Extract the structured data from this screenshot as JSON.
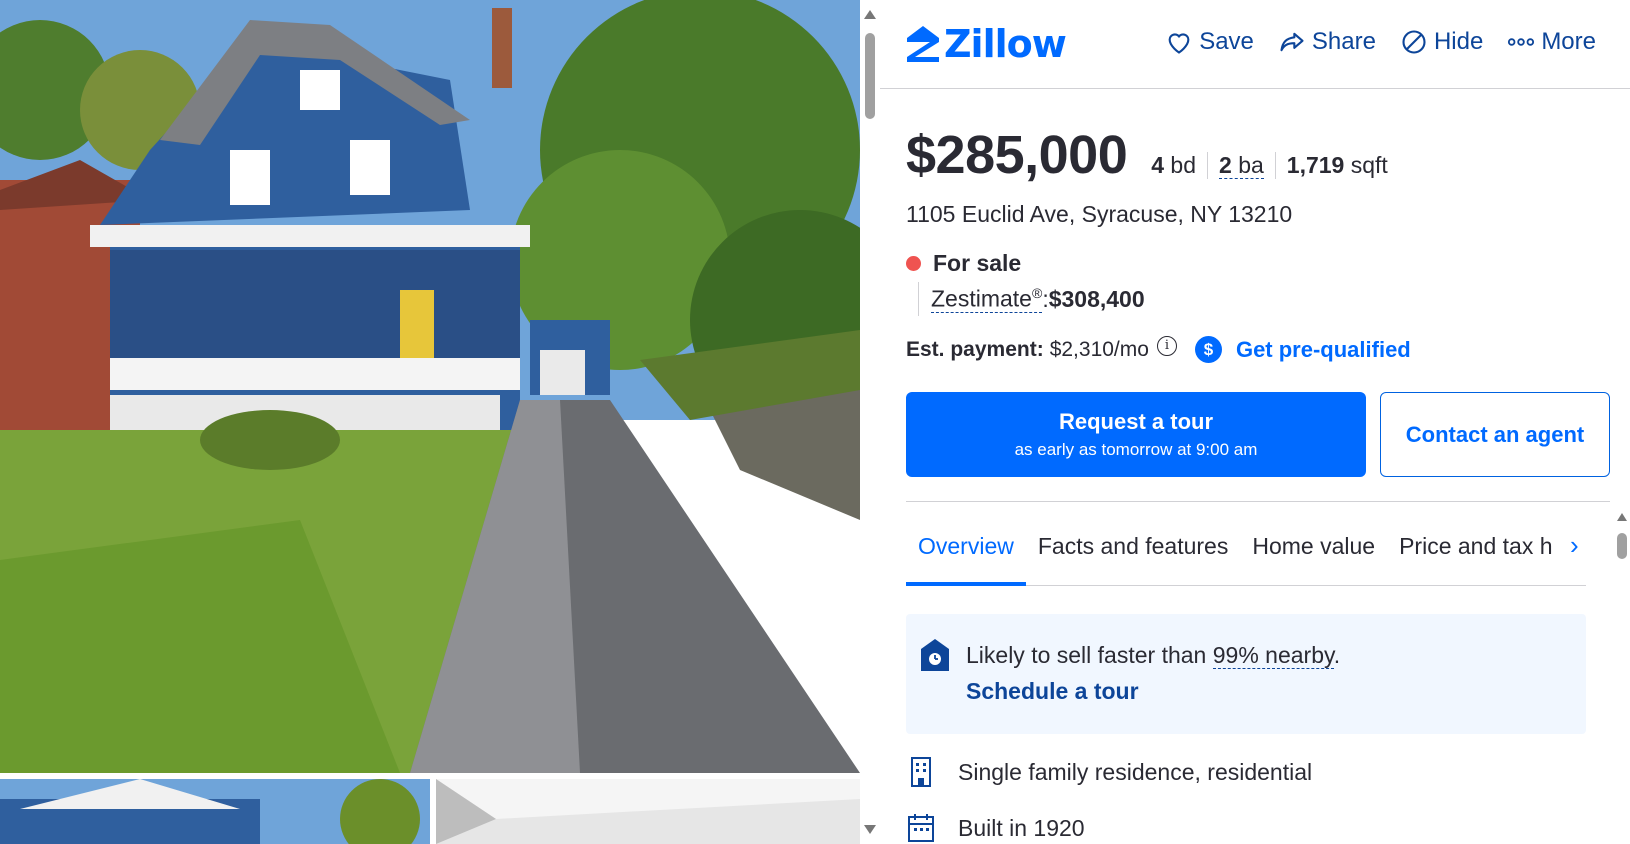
{
  "logo": {
    "text": "Zillow"
  },
  "actions": [
    {
      "label": "Save",
      "icon": "heart-icon"
    },
    {
      "label": "Share",
      "icon": "share-icon"
    },
    {
      "label": "Hide",
      "icon": "hide-icon"
    },
    {
      "label": "More",
      "icon": "more-icon"
    }
  ],
  "listing": {
    "price": "$285,000",
    "beds_value": "4",
    "beds_unit": "bd",
    "baths_value": "2",
    "baths_unit": "ba",
    "sqft_value": "1,719",
    "sqft_unit": "sqft",
    "address": "1105 Euclid Ave, Syracuse, NY 13210",
    "status": "For sale",
    "zestimate_label": "Zestimate",
    "zestimate_reg": "®",
    "zestimate_sep": ": ",
    "zestimate_value": "$308,400",
    "payment_label": "Est. payment:",
    "payment_value": "$2,310/mo",
    "prequalify_label": "Get pre-qualified"
  },
  "buttons": {
    "tour_title": "Request a tour",
    "tour_sub": "as early as tomorrow at 9:00 am",
    "agent": "Contact an agent"
  },
  "tabs": [
    "Overview",
    "Facts and features",
    "Home value",
    "Price and tax h"
  ],
  "highlight": {
    "text_before": "Likely to sell faster than ",
    "link": "99% nearby",
    "text_after": ".",
    "action": "Schedule a tour"
  },
  "facts": [
    {
      "icon": "building-icon",
      "text": "Single family residence, residential"
    },
    {
      "icon": "calendar-icon",
      "text": "Built in 1920"
    }
  ],
  "colors": {
    "accent": "#006aff",
    "dark_link": "#0d4599",
    "status_dot": "#ef5350"
  }
}
